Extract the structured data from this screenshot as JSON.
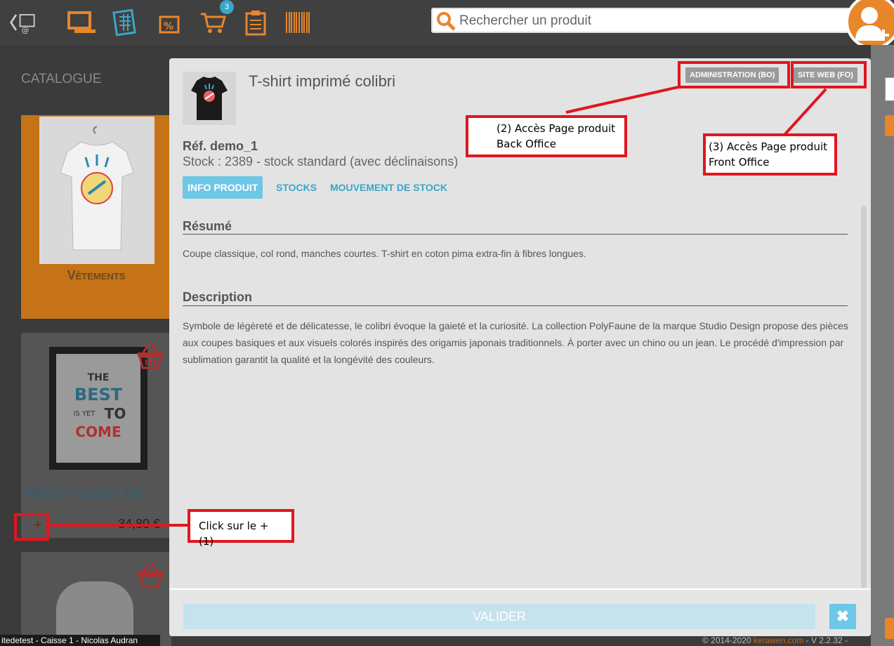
{
  "topbar": {
    "badge_count": "3",
    "search_placeholder": "Rechercher un produit"
  },
  "catalogue": {
    "title": "CATALOGUE",
    "category_label": "Vêtements",
    "product1_name": "Affiche encadrée The…",
    "product1_price": "34,80 €"
  },
  "modal": {
    "title": "T-shirt imprimé colibri",
    "admin_button": "ADMINISTRATION (BO)",
    "site_button": "SITE WEB (FO)",
    "reference": "Réf. demo_1",
    "stock": "Stock : 2389 - stock standard (avec déclinaisons)",
    "tabs": [
      "INFO PRODUIT",
      "STOCKS",
      "MOUVEMENT DE STOCK"
    ],
    "summary_title": "Résumé",
    "summary_text": "Coupe classique, col rond, manches courtes. T-shirt en coton pima extra-fin à fibres longues.",
    "description_title": "Description",
    "description_text": "Symbole de légèreté et de délicatesse, le colibri évoque la gaieté et la curiosité. La collection PolyFaune de la marque Studio Design propose des pièces aux coupes basiques et aux visuels colorés inspirés des origamis japonais traditionnels. À porter avec un chino ou un jean. Le procédé d'impression par sublimation garantit la qualité et la longévité des couleurs.",
    "validate_button": "VALIDER",
    "close_symbol": "✖"
  },
  "annotations": {
    "note1": "Click sur le + (1)",
    "note2_line1": "(2) Accès Page produit",
    "note2_line2": "Back Office",
    "note3_line1": "(3) Accès Page produit",
    "note3_line2": "Front Office"
  },
  "footer": {
    "left": "itedetest - Caisse 1 - Nicolas Audran",
    "right_prefix": "© 2014-2020",
    "brand": "kerawen.com",
    "version": "- V 2.2.32 -"
  },
  "colors": {
    "accent_orange": "#e8862a",
    "accent_blue": "#3aa6c9",
    "annotation_red": "#e0161f"
  }
}
